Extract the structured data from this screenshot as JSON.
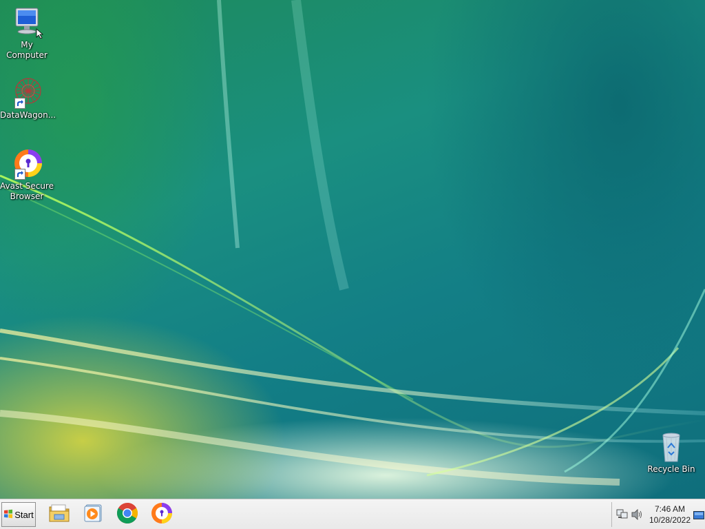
{
  "desktop": {
    "icons": [
      {
        "label": "My Computer",
        "icon": "computer-icon"
      },
      {
        "label": "DataWagon...",
        "icon": "datawagon-icon",
        "shortcut": true
      },
      {
        "label": "Avast Secure Browser",
        "icon": "avast-browser-icon",
        "shortcut": true
      },
      {
        "label": "Recycle Bin",
        "icon": "recycle-bin-icon"
      }
    ]
  },
  "taskbar": {
    "start_label": "Start",
    "pinned": [
      {
        "icon": "file-explorer-icon"
      },
      {
        "icon": "media-player-icon"
      },
      {
        "icon": "chrome-icon"
      },
      {
        "icon": "avast-browser-icon"
      }
    ],
    "tray": {
      "icons": [
        "network-icon",
        "volume-icon",
        "show-desktop-icon"
      ],
      "time": "7:46 AM",
      "date": "10/28/2022"
    }
  },
  "colors": {
    "taskbar_bg": "#eeeeee",
    "wallpaper_teal": "#137f86",
    "wallpaper_green": "#1d8a5a",
    "wallpaper_yellow": "#e6dc3c"
  }
}
